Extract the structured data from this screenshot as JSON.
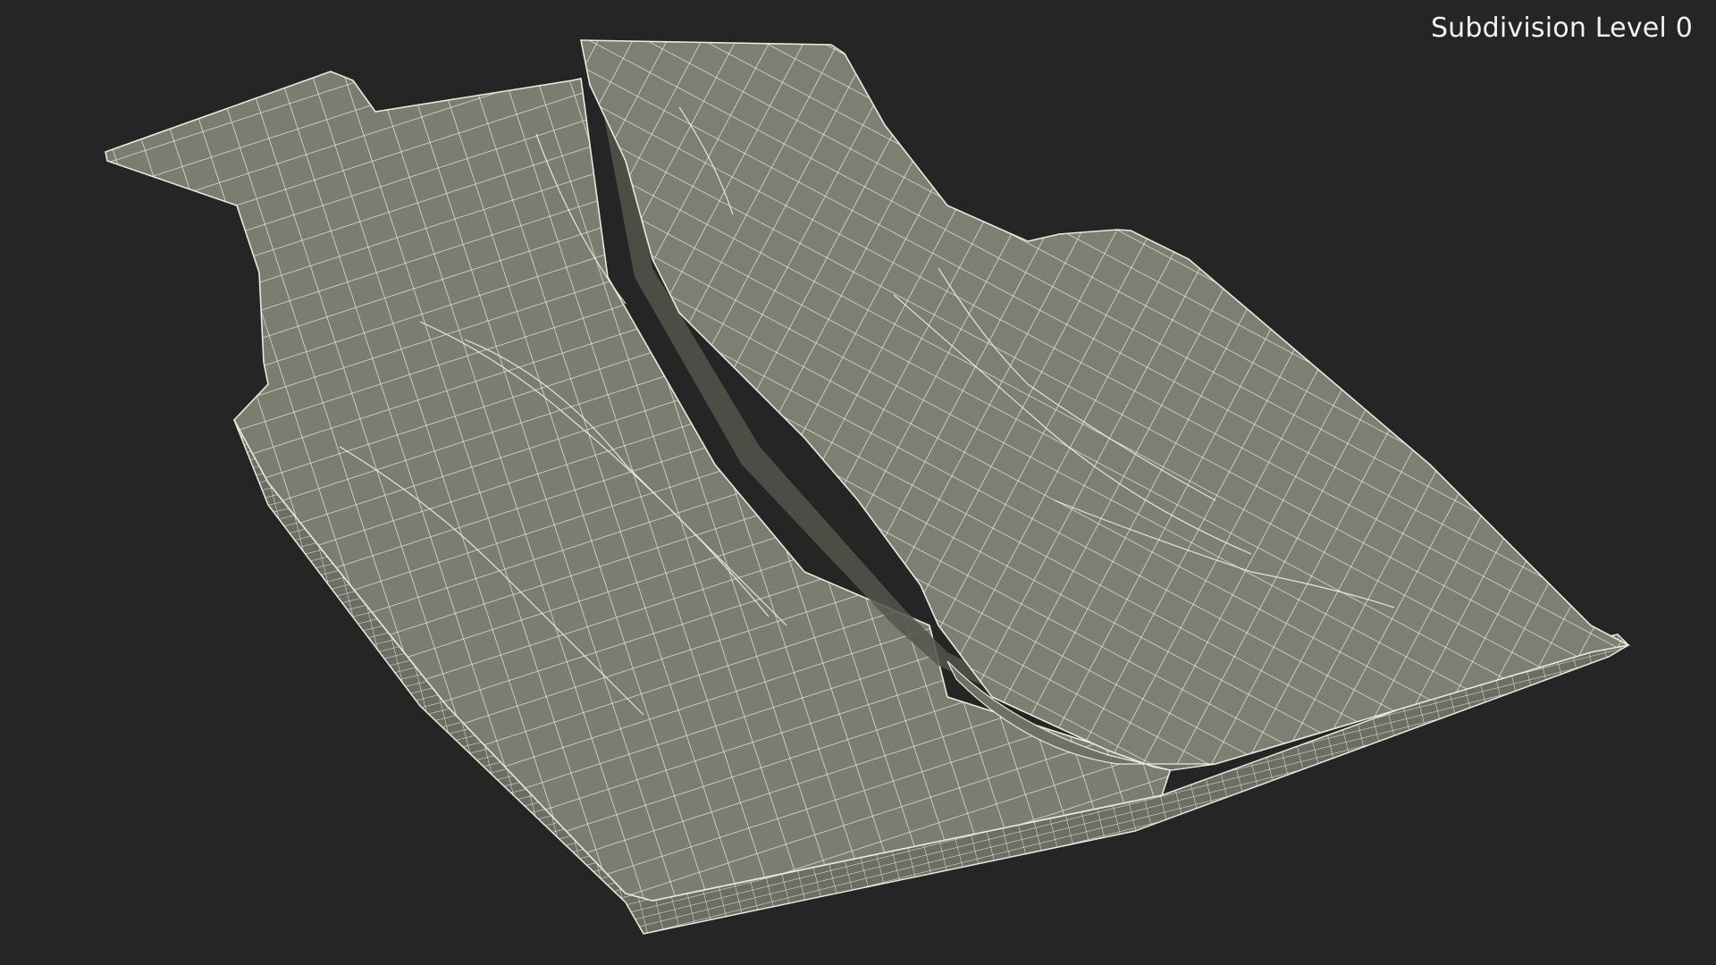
{
  "viewport": {
    "label": "Subdivision Level 0",
    "background_color": "#252525",
    "surface_color": "#7b7d70",
    "wire_color": "#f3f0e6",
    "shadow_color": "#575a50",
    "subject": "folded vest wireframe mesh"
  }
}
